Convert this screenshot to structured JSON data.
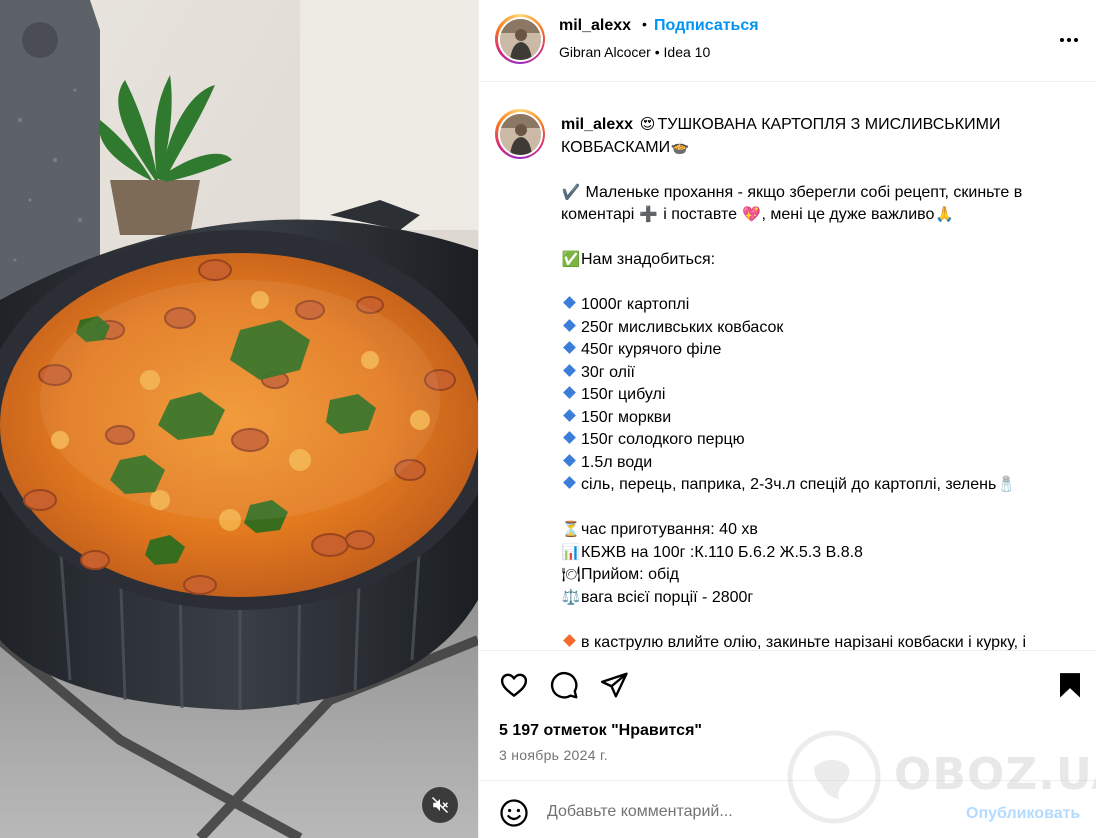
{
  "post": {
    "username": "mil_alexx",
    "follow_label": "Подписаться",
    "separator": "•",
    "audio_artist": "Gibran Alcocer",
    "audio_track": "Idea 10",
    "more_icon": "more-options-icon"
  },
  "caption": {
    "title_emoji_start": "😍",
    "title_line1": "ТУШКОВАНА КАРТОПЛЯ З МИСЛИВСЬКИМИ",
    "title_line2": "КОВБАСКАМИ",
    "title_emoji_end": "🍲",
    "request_emoji": "✔️",
    "request_line1": " Маленьке прохання - якщо зберегли собі рецепт, скиньте в",
    "request_line2_a": "коментарі ",
    "request_plus": "➕",
    "request_line2_b": " і поставте ",
    "request_heart": "💖",
    "request_line2_c": ", мені це дуже важливо",
    "request_pray": "🙏",
    "need_emoji": "✅",
    "need_label": "Нам знадобиться:",
    "ingredients": [
      "1000г картоплі",
      "250г мисливських ковбасок",
      "450г курячого філе",
      "30г олії",
      "150г цибулі",
      "150г моркви",
      "150г солодкого перцю",
      "1.5л води",
      "сіль, перець, паприка, 2-3ч.л спецій до картоплі, зелень"
    ],
    "salt_emoji": "🧂",
    "time_emoji": "⏳",
    "time": "час приготування: 40 хв",
    "kbzhv_emoji": "📊",
    "kbzhv": "КБЖВ на 100г :К.110 Б.6.2 Ж.5.3 В.8.8",
    "meal_emoji": "🍽",
    "meal": "Прийом: обід",
    "weight_emoji": "⚖️",
    "weight": "вага всієї порції - 2800г",
    "step1": "в каструлю влийте олію, закиньте нарізані ковбаски і курку, і"
  },
  "actions": {
    "like_icon": "heart-icon",
    "comment_icon": "comment-icon",
    "share_icon": "share-icon",
    "save_icon": "bookmark-icon",
    "likes_text": "5 197 отметок \"Нравится\"",
    "date": "3 ноябрь 2024 г."
  },
  "comment": {
    "emoji_icon": "smile-icon",
    "placeholder": "Добавьте комментарий...",
    "publish_label": "Опубликовать"
  },
  "media": {
    "mute_icon": "speaker-muted-icon"
  },
  "watermark": {
    "text": "OBOZ.UA"
  },
  "colors": {
    "link_blue": "#0095f6",
    "publish_disabled": "#b3dbff",
    "secondary_text": "#737373",
    "divider": "#efefef",
    "diamond_blue": "#3b7dd8",
    "diamond_orange": "#f26b2a"
  }
}
